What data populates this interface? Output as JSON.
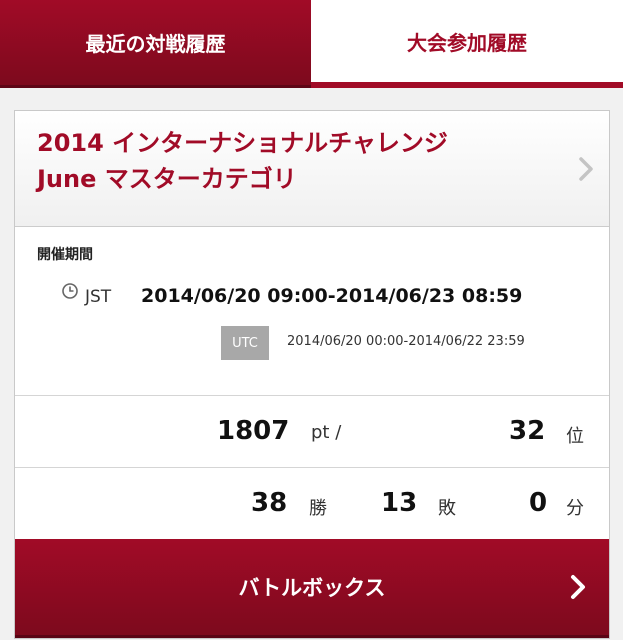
{
  "tabs": {
    "recent_battles": "最近の対戦履歴",
    "tournament_history": "大会参加履歴"
  },
  "event": {
    "title_line1": "2014 インターナショナルチャレンジ",
    "title_line2": "June マスターカテゴリ",
    "period_label": "開催期間",
    "jst_label": "JST",
    "jst_period": "2014/06/20 09:00-2014/06/23 08:59",
    "utc_label": "UTC",
    "utc_period": "2014/06/20 00:00-2014/06/22 23:59"
  },
  "stats": {
    "points": "1807",
    "points_unit": "pt /",
    "rank": "32",
    "rank_unit": "位",
    "wins": "38",
    "wins_unit": "勝",
    "losses": "13",
    "losses_unit": "敗",
    "draws": "0",
    "draws_unit": "分"
  },
  "footer": {
    "button_label": "バトルボックス"
  },
  "colors": {
    "accent": "#a10b27",
    "accent_dark": "#7d0a1d",
    "badge_gray": "#a8a8a8"
  },
  "icons": {
    "detail": "chevron-right-icon",
    "time": "clock-icon"
  }
}
